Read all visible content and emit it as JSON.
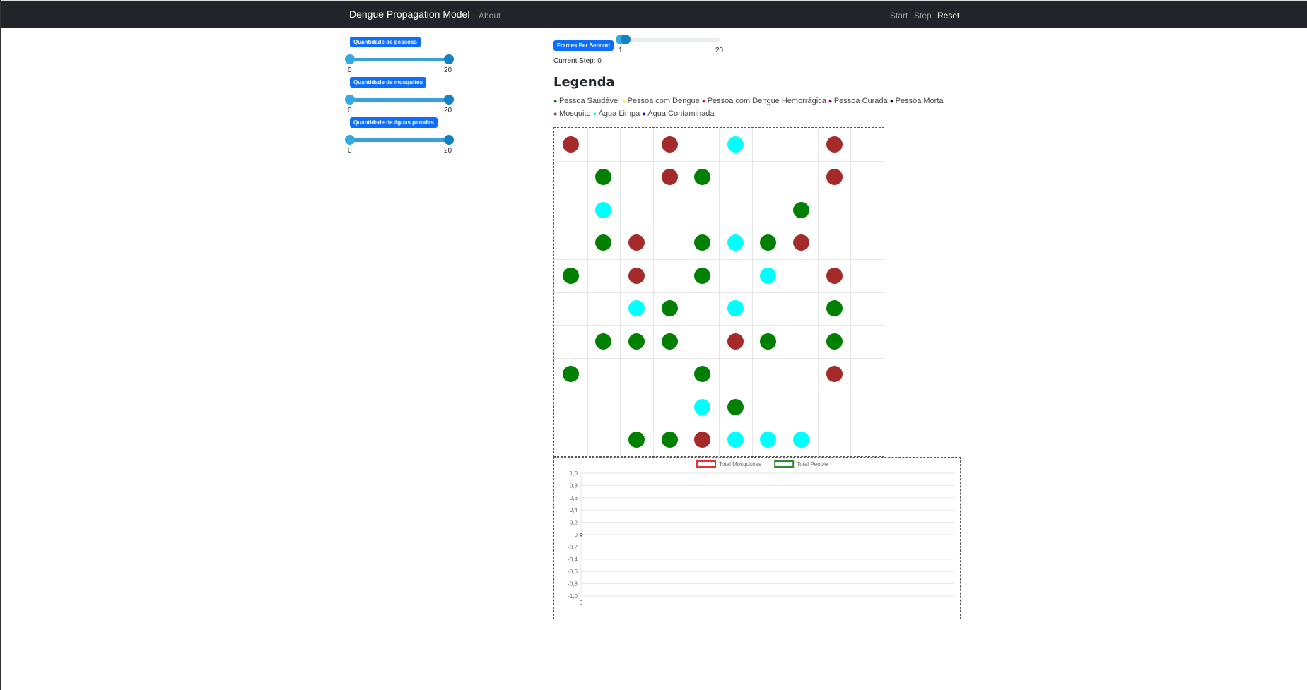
{
  "navbar": {
    "brand": "Dengue Propagation Model",
    "about": "About",
    "start": "Start",
    "step": "Step",
    "reset": "Reset"
  },
  "controls": {
    "people": {
      "label": "Quantidade de pessoas",
      "min": "0",
      "max": "20",
      "value_min": 0,
      "value_max": 20,
      "range": [
        0,
        20
      ]
    },
    "mosquitos": {
      "label": "Quantidade de mosquitos",
      "min": "0",
      "max": "20",
      "value_min": 0,
      "value_max": 20,
      "range": [
        0,
        20
      ]
    },
    "water": {
      "label": "Quantidade de águas paradas",
      "min": "0",
      "max": "20",
      "value_min": 0,
      "value_max": 20,
      "range": [
        0,
        20
      ]
    },
    "fps": {
      "label": "Frames Per Second",
      "min": "1",
      "max": "20",
      "value_min": 1,
      "value_max": 2,
      "range": [
        1,
        20
      ]
    }
  },
  "current_step": "Current Step: 0",
  "legend": {
    "title": "Legenda",
    "items": [
      {
        "label": "Pessoa Saudável",
        "color": "#008000"
      },
      {
        "label": "Pessoa com Dengue",
        "color": "#ffff00"
      },
      {
        "label": "Pessoa com Dengue Hemorrágica",
        "color": "#ff0000"
      },
      {
        "label": "Pessoa Curada",
        "color": "#800080"
      },
      {
        "label": "Pessoa Morta",
        "color": "#000000"
      },
      {
        "label": "Mosquito",
        "color": "#a52a2a"
      },
      {
        "label": "Água Limpa",
        "color": "#00ffff"
      },
      {
        "label": "Água Contaminada",
        "color": "#0000ff"
      }
    ]
  },
  "grid": {
    "columns": 10,
    "rows": 10,
    "colors": {
      "G": "#008000",
      "M": "#a52a2a",
      "W": "#00ffff"
    },
    "cells": [
      [
        "M",
        "",
        "",
        "M",
        "",
        "W",
        "",
        "",
        "M",
        ""
      ],
      [
        "",
        "G",
        "",
        "M",
        "G",
        "",
        "",
        "",
        "M",
        ""
      ],
      [
        "",
        "W",
        "",
        "",
        "",
        "",
        "",
        "G",
        "",
        ""
      ],
      [
        "",
        "G",
        "M",
        "",
        "G",
        "W",
        "G",
        "M",
        "",
        ""
      ],
      [
        "G",
        "",
        "M",
        "",
        "G",
        "",
        "W",
        "",
        "M",
        ""
      ],
      [
        "",
        "",
        "W",
        "G",
        "",
        "W",
        "",
        "",
        "G",
        ""
      ],
      [
        "",
        "G",
        "G",
        "G",
        "",
        "M",
        "G",
        "",
        "G",
        ""
      ],
      [
        "G",
        "",
        "",
        "",
        "G",
        "",
        "",
        "",
        "M",
        ""
      ],
      [
        "",
        "",
        "",
        "",
        "W",
        "G",
        "",
        "",
        "",
        ""
      ],
      [
        "",
        "",
        "G",
        "G",
        "M",
        "W",
        "W",
        "W",
        "",
        ""
      ]
    ]
  },
  "chart_data": {
    "type": "line",
    "series": [
      {
        "name": "Total Mosquitoes",
        "color": "#e83030",
        "x": [
          0
        ],
        "y": [
          0
        ]
      },
      {
        "name": "Total People",
        "color": "#2e8b2e",
        "x": [
          0
        ],
        "y": [
          0
        ]
      }
    ],
    "x_ticks": [
      "0"
    ],
    "y_ticks": [
      "1,0",
      "0,8",
      "0,6",
      "0,4",
      "0,2",
      "0",
      "-0,2",
      "-0,4",
      "-0,6",
      "-0,8",
      "-1,0"
    ],
    "ylim": [
      -1,
      1
    ],
    "legend_position": "top",
    "grid": true
  }
}
